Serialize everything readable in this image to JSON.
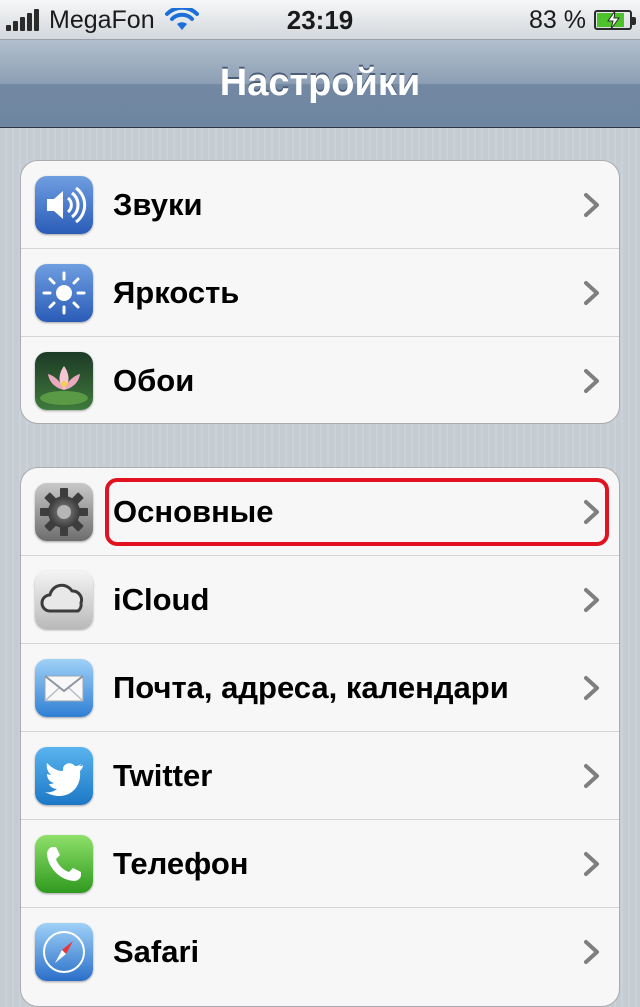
{
  "status_bar": {
    "carrier": "MegaFon",
    "time": "23:19",
    "battery_percent": "83 %",
    "battery_level": 0.83
  },
  "nav_bar": {
    "title": "Настройки"
  },
  "groups": [
    {
      "items": [
        {
          "label": "Звуки",
          "icon": "speaker-icon"
        },
        {
          "label": "Яркость",
          "icon": "brightness-icon"
        },
        {
          "label": "Обои",
          "icon": "wallpaper-icon"
        }
      ]
    },
    {
      "items": [
        {
          "label": "Основные",
          "icon": "gear-icon",
          "highlighted": true
        },
        {
          "label": "iCloud",
          "icon": "cloud-icon"
        },
        {
          "label": "Почта, адреса, календари",
          "icon": "mail-icon"
        },
        {
          "label": "Twitter",
          "icon": "twitter-bird-icon"
        },
        {
          "label": "Телефон",
          "icon": "phone-icon"
        },
        {
          "label": "Safari",
          "icon": "compass-icon"
        }
      ]
    }
  ],
  "colors": {
    "highlight": "#e0131f",
    "battery_fill": "#4dc32b",
    "nav_bar": "#7388a2"
  }
}
